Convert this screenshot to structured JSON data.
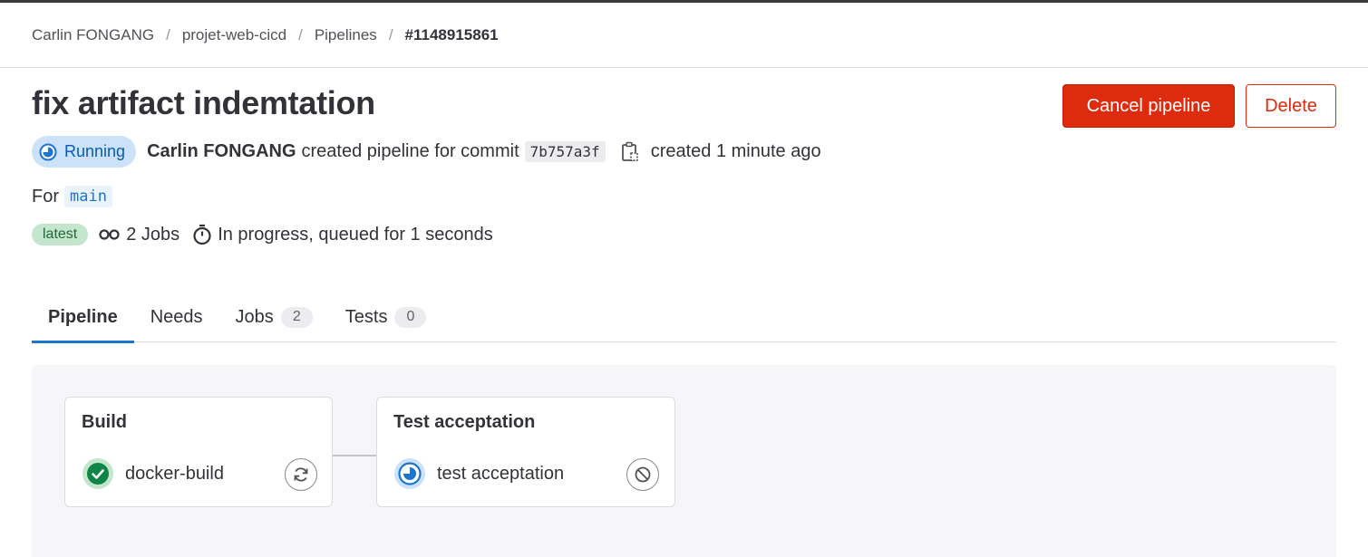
{
  "breadcrumb": {
    "items": [
      "Carlin FONGANG",
      "projet-web-cicd",
      "Pipelines"
    ],
    "current": "#1148915861",
    "separator": "/"
  },
  "page": {
    "title": "fix artifact indemtation"
  },
  "actions": {
    "cancel_label": "Cancel pipeline",
    "delete_label": "Delete"
  },
  "pipeline": {
    "status": "Running",
    "author": "Carlin FONGANG",
    "created_text": "created pipeline for commit",
    "commit_sha": "7b757a3f",
    "created_ago": "created 1 minute ago",
    "for_label": "For",
    "ref": "main",
    "latest_badge": "latest",
    "jobs_text": "2 Jobs",
    "progress_text": "In progress, queued for 1 seconds"
  },
  "tabs": [
    {
      "label": "Pipeline",
      "count": null
    },
    {
      "label": "Needs",
      "count": null
    },
    {
      "label": "Jobs",
      "count": "2"
    },
    {
      "label": "Tests",
      "count": "0"
    }
  ],
  "stages": [
    {
      "title": "Build",
      "job": {
        "name": "docker-build",
        "status": "success",
        "action": "retry"
      }
    },
    {
      "title": "Test acceptation",
      "job": {
        "name": "test acceptation",
        "status": "running",
        "action": "cancel"
      }
    }
  ],
  "icons": {
    "status_running": "status-running-icon",
    "status_success": "status-success-icon",
    "copy": "copy-to-clipboard-icon",
    "jobs": "pipeline-jobs-icon",
    "timer": "timer-icon",
    "retry": "retry-icon",
    "cancel": "cancel-icon"
  },
  "colors": {
    "danger": "#dd2b0e",
    "running": "#1f75cb",
    "success": "#108548",
    "tab_active": "#1f75cb"
  }
}
